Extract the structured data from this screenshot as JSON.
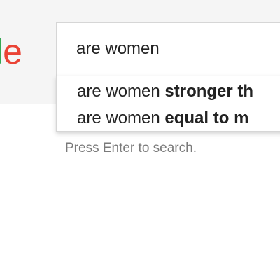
{
  "logo": {
    "letters": [
      "l",
      "e"
    ],
    "colors": {
      "l": "#34a853",
      "e": "#ea4335"
    }
  },
  "search": {
    "value": "are women"
  },
  "suggestions": [
    {
      "prefix": "are women ",
      "completion": "stronger th"
    },
    {
      "prefix": "are women ",
      "completion": "equal to m"
    }
  ],
  "hint": "Press Enter to search."
}
